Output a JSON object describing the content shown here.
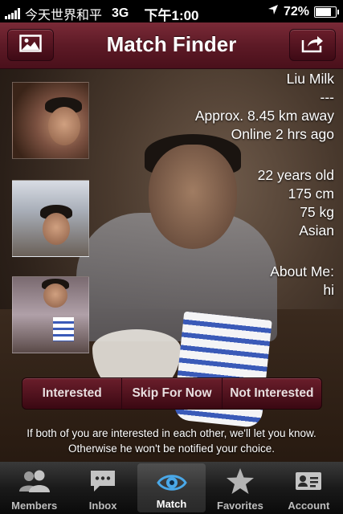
{
  "status_bar": {
    "carrier": "今天世界和平",
    "network": "3G",
    "time": "下午1:00",
    "battery": "72%",
    "battery_level": 0.72
  },
  "nav": {
    "title": "Match Finder",
    "left_icon": "photo-icon",
    "right_icon": "share-icon"
  },
  "profile": {
    "name": "Liu Milk",
    "tagline": "---",
    "distance": "Approx. 8.45 km away",
    "online": "Online 2 hrs ago",
    "age": "22 years old",
    "height": "175 cm",
    "weight": "75 kg",
    "ethnicity": "Asian",
    "about_label": "About Me:",
    "about_text": "hi"
  },
  "actions": {
    "interested": "Interested",
    "skip": "Skip For Now",
    "not_interested": "Not Interested"
  },
  "notice": {
    "line1": "If both of you are interested in each other, we'll let you know.",
    "line2": "Otherwise he won't be notified your choice."
  },
  "tabs": [
    {
      "label": "Members",
      "icon": "members-icon",
      "active": false
    },
    {
      "label": "Inbox",
      "icon": "chat-bubble-icon",
      "active": false
    },
    {
      "label": "Match",
      "icon": "eye-icon",
      "active": true
    },
    {
      "label": "Favorites",
      "icon": "star-icon",
      "active": false
    },
    {
      "label": "Account",
      "icon": "id-card-icon",
      "active": false
    }
  ],
  "colors": {
    "nav_bar": "#5d1a26",
    "tab_bar": "#1a1a1a",
    "active_tab_icon": "#4aa8e8"
  }
}
